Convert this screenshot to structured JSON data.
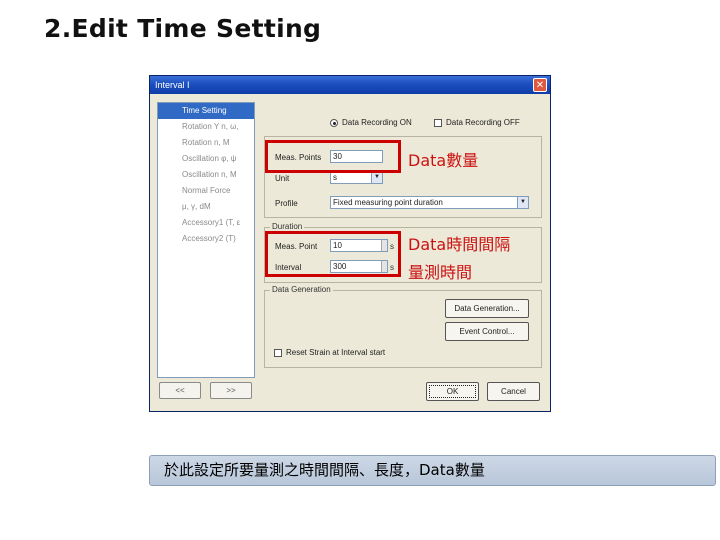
{
  "slide": {
    "title": "2.Edit Time Setting"
  },
  "dialog": {
    "title": "Interval I",
    "close_glyph": "✕",
    "nav_items": [
      "Time Setting",
      "Rotation Y n, ω,",
      "Rotation n, M",
      "Oscillation φ, ψ",
      "Oscillation n, M",
      "Normal Force",
      "μ, γ, dM",
      "Accessory1 (T, ε",
      "Accessory2 (T)"
    ],
    "nav_prev": "<<",
    "nav_next": ">>",
    "recording_on": "Data Recording ON",
    "recording_off": "Data Recording OFF",
    "meas_points_label": "Meas. Points",
    "meas_points_value": "30",
    "unit_label": "Unit",
    "unit_value": "s",
    "profile_label": "Profile",
    "profile_value": "Fixed measuring point duration",
    "duration_label": "Duration",
    "duration_points_label": "Meas. Point",
    "duration_points_value": "10",
    "duration_points_unit": "s",
    "interval_label": "Interval",
    "interval_value": "300",
    "interval_unit": "s",
    "data_generation_label": "Data Generation",
    "data_generation_button": "Data Generation...",
    "event_control_button": "Event Control...",
    "reset_label": "Reset Strain at Interval start",
    "ok_button": "OK",
    "cancel_button": "Cancel"
  },
  "annotations": {
    "data_count": "Data數量",
    "data_interval": "Data時間間隔",
    "measure_time": "量測時間"
  },
  "caption": "於此設定所要量測之時間間隔、長度，Data數量"
}
